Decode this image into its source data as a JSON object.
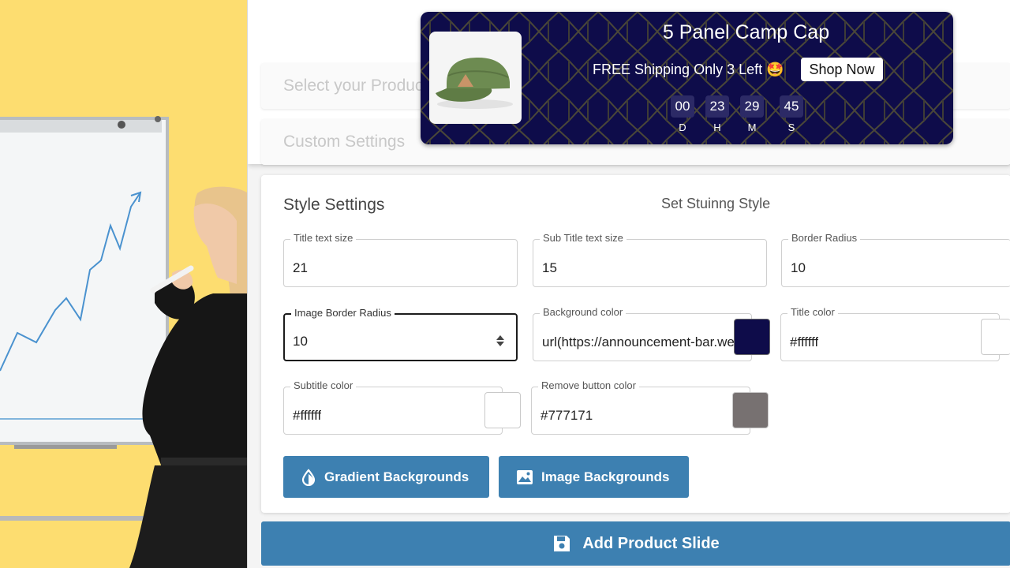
{
  "accordion": {
    "product_label": "Select your Product",
    "custom_label": "Custom Settings"
  },
  "preview": {
    "title": "5 Panel Camp Cap",
    "subtitle": "FREE Shipping Only 3 Left 🤩",
    "button_label": "Shop Now",
    "background_color": "#0e0c4a",
    "timer": [
      {
        "value": "00",
        "label": "D"
      },
      {
        "value": "23",
        "label": "H"
      },
      {
        "value": "29",
        "label": "M"
      },
      {
        "value": "45",
        "label": "S"
      }
    ]
  },
  "style_settings": {
    "heading": "Style Settings",
    "subheading": "Set Stuinng Style",
    "fields": {
      "title_size": {
        "label": "Title text size",
        "value": "21"
      },
      "subtitle_size": {
        "label": "Sub Title text size",
        "value": "15"
      },
      "border_radius": {
        "label": "Border Radius",
        "value": "10"
      },
      "image_radius": {
        "label": "Image Border Radius",
        "value": "10"
      },
      "background_color": {
        "label": "Background color",
        "value": "url(https://announcement-bar.webpro"
      },
      "title_color": {
        "label": "Title color",
        "value": "#ffffff"
      },
      "subtitle_color": {
        "label": "Subtitle color",
        "value": "#ffffff"
      },
      "remove_button_color": {
        "label": "Remove button color",
        "value": "#777171"
      }
    },
    "swatch_colors": {
      "background": "#0e0c4a",
      "title": "#ffffff",
      "subtitle": "#ffffff",
      "remove_button": "#777171"
    },
    "buttons": {
      "gradient": "Gradient Backgrounds",
      "image": "Image Backgrounds"
    }
  },
  "footer": {
    "add_slide": "Add Product Slide"
  },
  "icons": {
    "gradient": "droplet-icon",
    "image": "image-icon",
    "save": "floppy-disk-icon",
    "stepper": "stepper-arrows-icon"
  },
  "accent_color": "#3d80b1"
}
